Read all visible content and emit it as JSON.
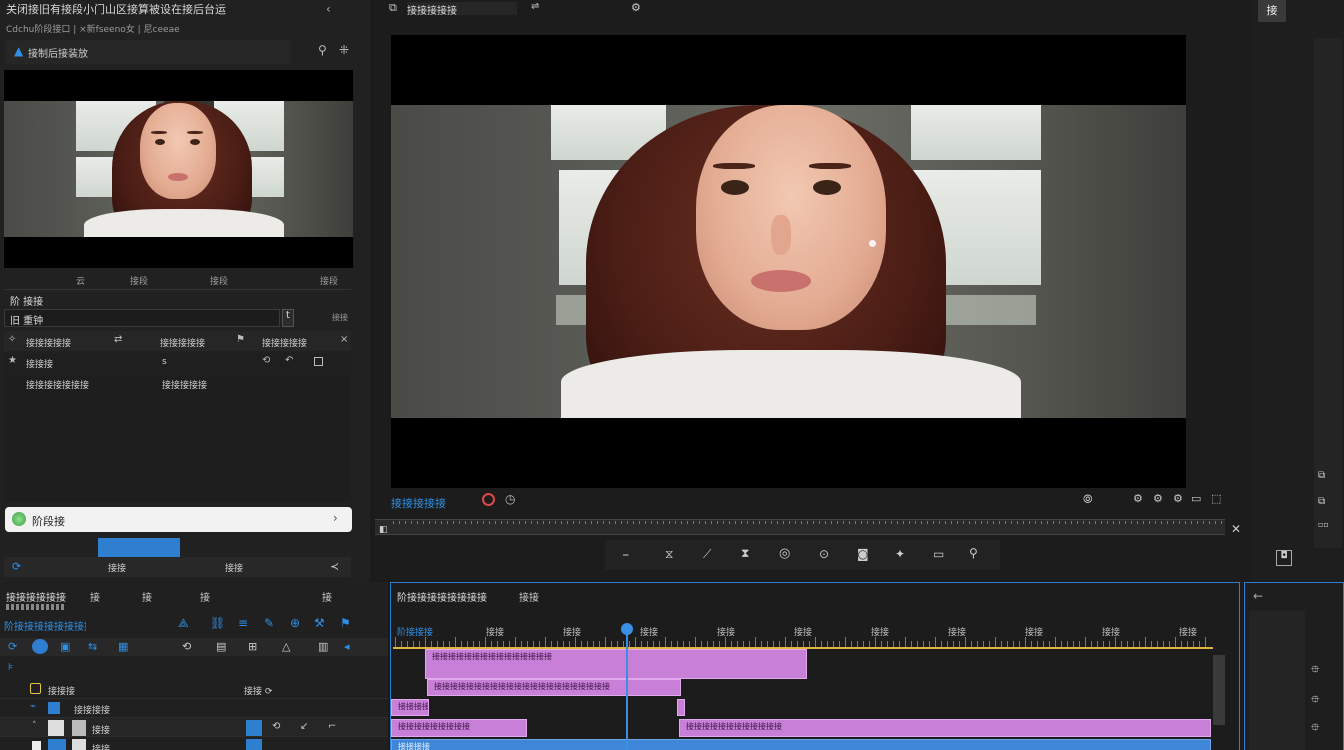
{
  "project_panel": {
    "title": "关闭接旧有接段小门山区接算被设在接后台运",
    "subtitle": "Cdchu阶段接口 | ×新fseeno女 | 尼ceeae",
    "source_label": "接制后接装放",
    "controls": [
      "云",
      "接段",
      "接段",
      "接段"
    ],
    "section_label": "阶 接接",
    "field_value": "旧 重钟",
    "field_button": "t",
    "field_side": "接接",
    "row1": [
      "接接接接接",
      "接接接接接",
      "接接接接接"
    ],
    "row2_label": "接接接",
    "row2_value": "s",
    "item_a": "接接接接接接接",
    "item_b": "接接接接接",
    "search_placeholder": "阶段接",
    "bottom_tabs": [
      "接接",
      "接接"
    ]
  },
  "program_monitor": {
    "title": "接接接接接",
    "timecode": "接接接接接",
    "bottom_tools": [
      "⎯",
      "接",
      "⟋",
      "中",
      "◎",
      "⊙",
      "◙",
      "✦",
      "▭",
      "⚲"
    ]
  },
  "timeline": {
    "title": "接接接接接接",
    "header_items": [
      "接",
      "接",
      "接",
      "接"
    ],
    "sequence_name": "阶接接接接接接接接",
    "sequence_tab": "接接",
    "current_tc": "阶接接接",
    "ruler_labels": [
      "接接",
      "接接",
      "接接",
      "接接",
      "接接",
      "接接",
      "接接",
      "接接",
      "接接",
      "接接",
      "接接"
    ],
    "tracks": [
      {
        "name": "接接接",
        "value": "接接 ⟳"
      },
      {
        "name": "接接接接",
        "value": ""
      },
      {
        "name": "接接",
        "value": ""
      },
      {
        "name": "接接",
        "value": ""
      }
    ],
    "clip_labels": [
      "接接接接接接接接接接接接接接接",
      "接接接接接接接接接接接接接接接接接接接接接接",
      "接接接接接",
      "接接接接接接接接接",
      "接接接",
      "接接接接接接接接接接接接",
      "接接接接",
      "接接接接接"
    ]
  },
  "right_toolbar": {
    "top_button": "接"
  },
  "colors": {
    "accent": "#2f8fe6",
    "clip_purple": "#c77fd8",
    "clip_blue": "#3f86d8",
    "playhead": "#3a8ee6",
    "ruler_line": "#e1b43a"
  }
}
